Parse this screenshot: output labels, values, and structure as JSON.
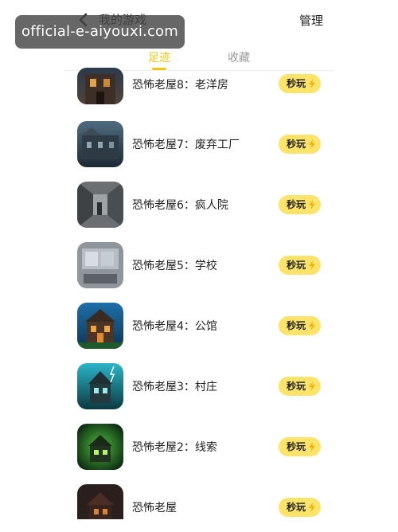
{
  "header": {
    "title": "我的游戏",
    "manage_label": "管理"
  },
  "watermark": "official-e-aiyouxi.com",
  "tabs": [
    {
      "label": "足迹",
      "active": true
    },
    {
      "label": "收藏",
      "active": false
    }
  ],
  "accent_color": "#f3c613",
  "button_color": "#fce36a",
  "games": [
    {
      "name": "恐怖老屋8：老洋房",
      "button": "秒玩",
      "icon": "haunted-mansion-icon"
    },
    {
      "name": "恐怖老屋7：废弃工厂",
      "button": "秒玩",
      "icon": "abandoned-factory-icon"
    },
    {
      "name": "恐怖老屋6：疯人院",
      "button": "秒玩",
      "icon": "asylum-corridor-icon"
    },
    {
      "name": "恐怖老屋5：学校",
      "button": "秒玩",
      "icon": "school-room-icon"
    },
    {
      "name": "恐怖老屋4：公馆",
      "button": "秒玩",
      "icon": "mansion-house-icon"
    },
    {
      "name": "恐怖老屋3：村庄",
      "button": "秒玩",
      "icon": "village-house-icon"
    },
    {
      "name": "恐怖老屋2：线索",
      "button": "秒玩",
      "icon": "green-house-icon"
    },
    {
      "name": "恐怖老屋",
      "button": "秒玩",
      "icon": "dark-house-icon"
    }
  ]
}
